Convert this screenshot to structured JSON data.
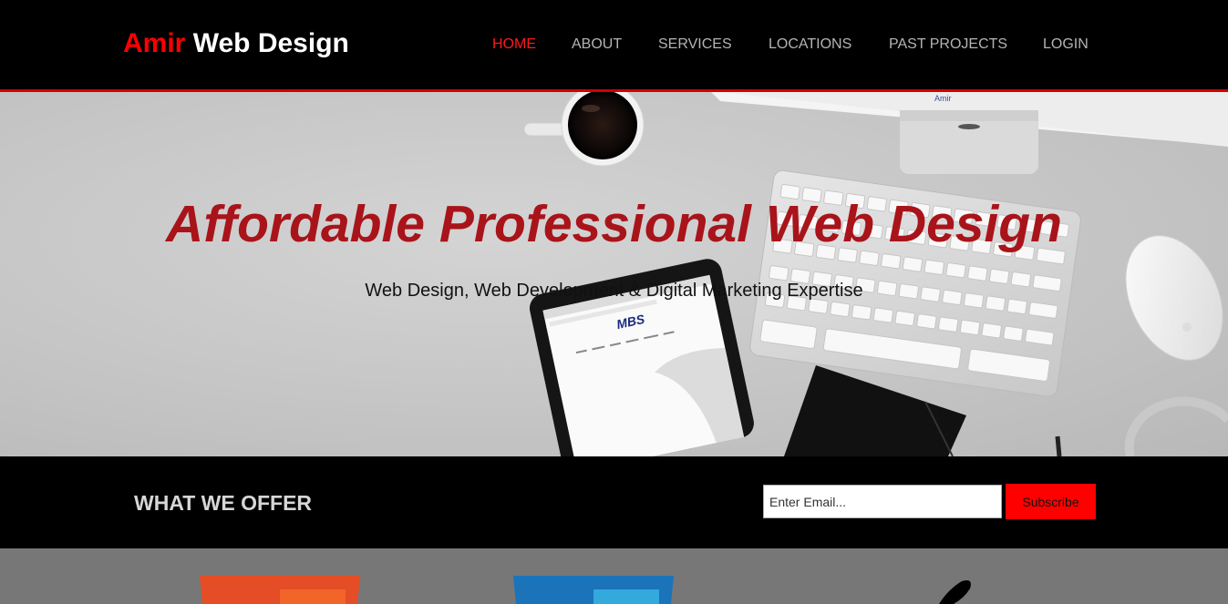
{
  "header": {
    "logo_part1": "Amir",
    "logo_part2": "Web Design",
    "nav": [
      {
        "label": "HOME",
        "active": true
      },
      {
        "label": "ABOUT",
        "active": false
      },
      {
        "label": "SERVICES",
        "active": false
      },
      {
        "label": "LOCATIONS",
        "active": false
      },
      {
        "label": "PAST PROJECTS",
        "active": false
      },
      {
        "label": "LOGIN",
        "active": false
      }
    ]
  },
  "hero": {
    "title": "Affordable Professional Web Design",
    "subtitle": "Web Design, Web Development & Digital Marketing Expertise",
    "tablet_logo": "MBS"
  },
  "offer": {
    "title": "WHAT WE OFFER",
    "email_placeholder": "Enter Email...",
    "subscribe_label": "Subscribe"
  },
  "services": {
    "icons": [
      "html5-icon",
      "css3-icon",
      "pen-icon"
    ]
  },
  "colors": {
    "brand_red": "#ff0000",
    "title_red": "#a8141a",
    "nav_gray": "#b4b4b4"
  }
}
